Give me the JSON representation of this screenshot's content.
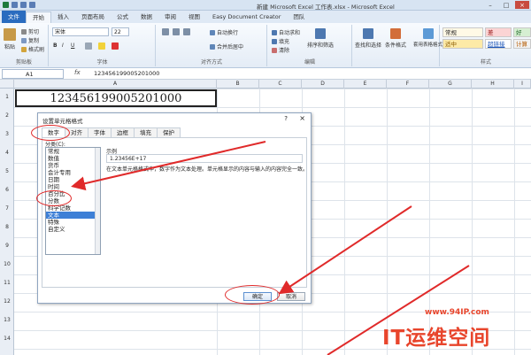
{
  "window": {
    "title": "新建 Microsoft Excel 工作表.xlsx - Microsoft Excel"
  },
  "ribbon_tabs": [
    "文件",
    "开始",
    "插入",
    "页面布局",
    "公式",
    "数据",
    "审阅",
    "视图",
    "Easy Document Creator",
    "团队"
  ],
  "active_tab": "开始",
  "clipboard": {
    "paste": "粘贴",
    "cut": "剪切",
    "copy": "复制",
    "format_painter": "格式刷",
    "group": "剪贴板"
  },
  "font": {
    "name": "宋体",
    "size": "22",
    "group": "字体",
    "bold": "B",
    "italic": "I",
    "underline": "U"
  },
  "alignment": {
    "wrap": "自动换行",
    "merge": "合并后居中",
    "group": "对齐方式"
  },
  "number": {
    "format": "常规",
    "group": "数字",
    "pct": "%"
  },
  "cells": {
    "autosum": "自动求和",
    "fill": "填充",
    "clear": "清除",
    "sort": "排序和筛选",
    "find": "查找和选择",
    "cond": "条件格式",
    "table": "套用表格格式",
    "group": "编辑"
  },
  "styles": {
    "normal": "常规",
    "bad": "差",
    "good": "好",
    "neutral": "适中",
    "hyperlink": "超链接",
    "calc": "计算",
    "group": "样式"
  },
  "formula_bar": {
    "name_box": "A1",
    "fx": "fx",
    "value": "123456199005201000"
  },
  "columns": [
    "A",
    "B",
    "C",
    "D",
    "E",
    "F",
    "G",
    "H",
    "I"
  ],
  "rows": [
    "1",
    "2",
    "3",
    "4",
    "5",
    "6",
    "7",
    "8",
    "9",
    "10",
    "11",
    "12",
    "13",
    "14"
  ],
  "cell_a1": "123456199005201000",
  "dialog": {
    "title": "设置单元格格式",
    "help": "?",
    "close": "×",
    "tabs": [
      "数字",
      "对齐",
      "字体",
      "边框",
      "填充",
      "保护"
    ],
    "active_tab": "数字",
    "category_label": "分类(C):",
    "categories": [
      "常规",
      "数值",
      "货币",
      "会计专用",
      "日期",
      "时间",
      "百分比",
      "分数",
      "科学记数",
      "文本",
      "特殊",
      "自定义"
    ],
    "selected_category": "文本",
    "sample_label": "示例",
    "sample_value": "1.23456E+17",
    "description": "在文本单元格格式中，数字作为文本处理。单元格显示的内容与输入的内容完全一致。",
    "ok": "确定",
    "cancel": "取消"
  },
  "watermark": {
    "url": "www.94IP.com",
    "brand": "IT运维空间"
  },
  "colors": {
    "accent": "#2a6cbf",
    "annotation": "#e02a2a",
    "selected": "#3d7fd6"
  }
}
